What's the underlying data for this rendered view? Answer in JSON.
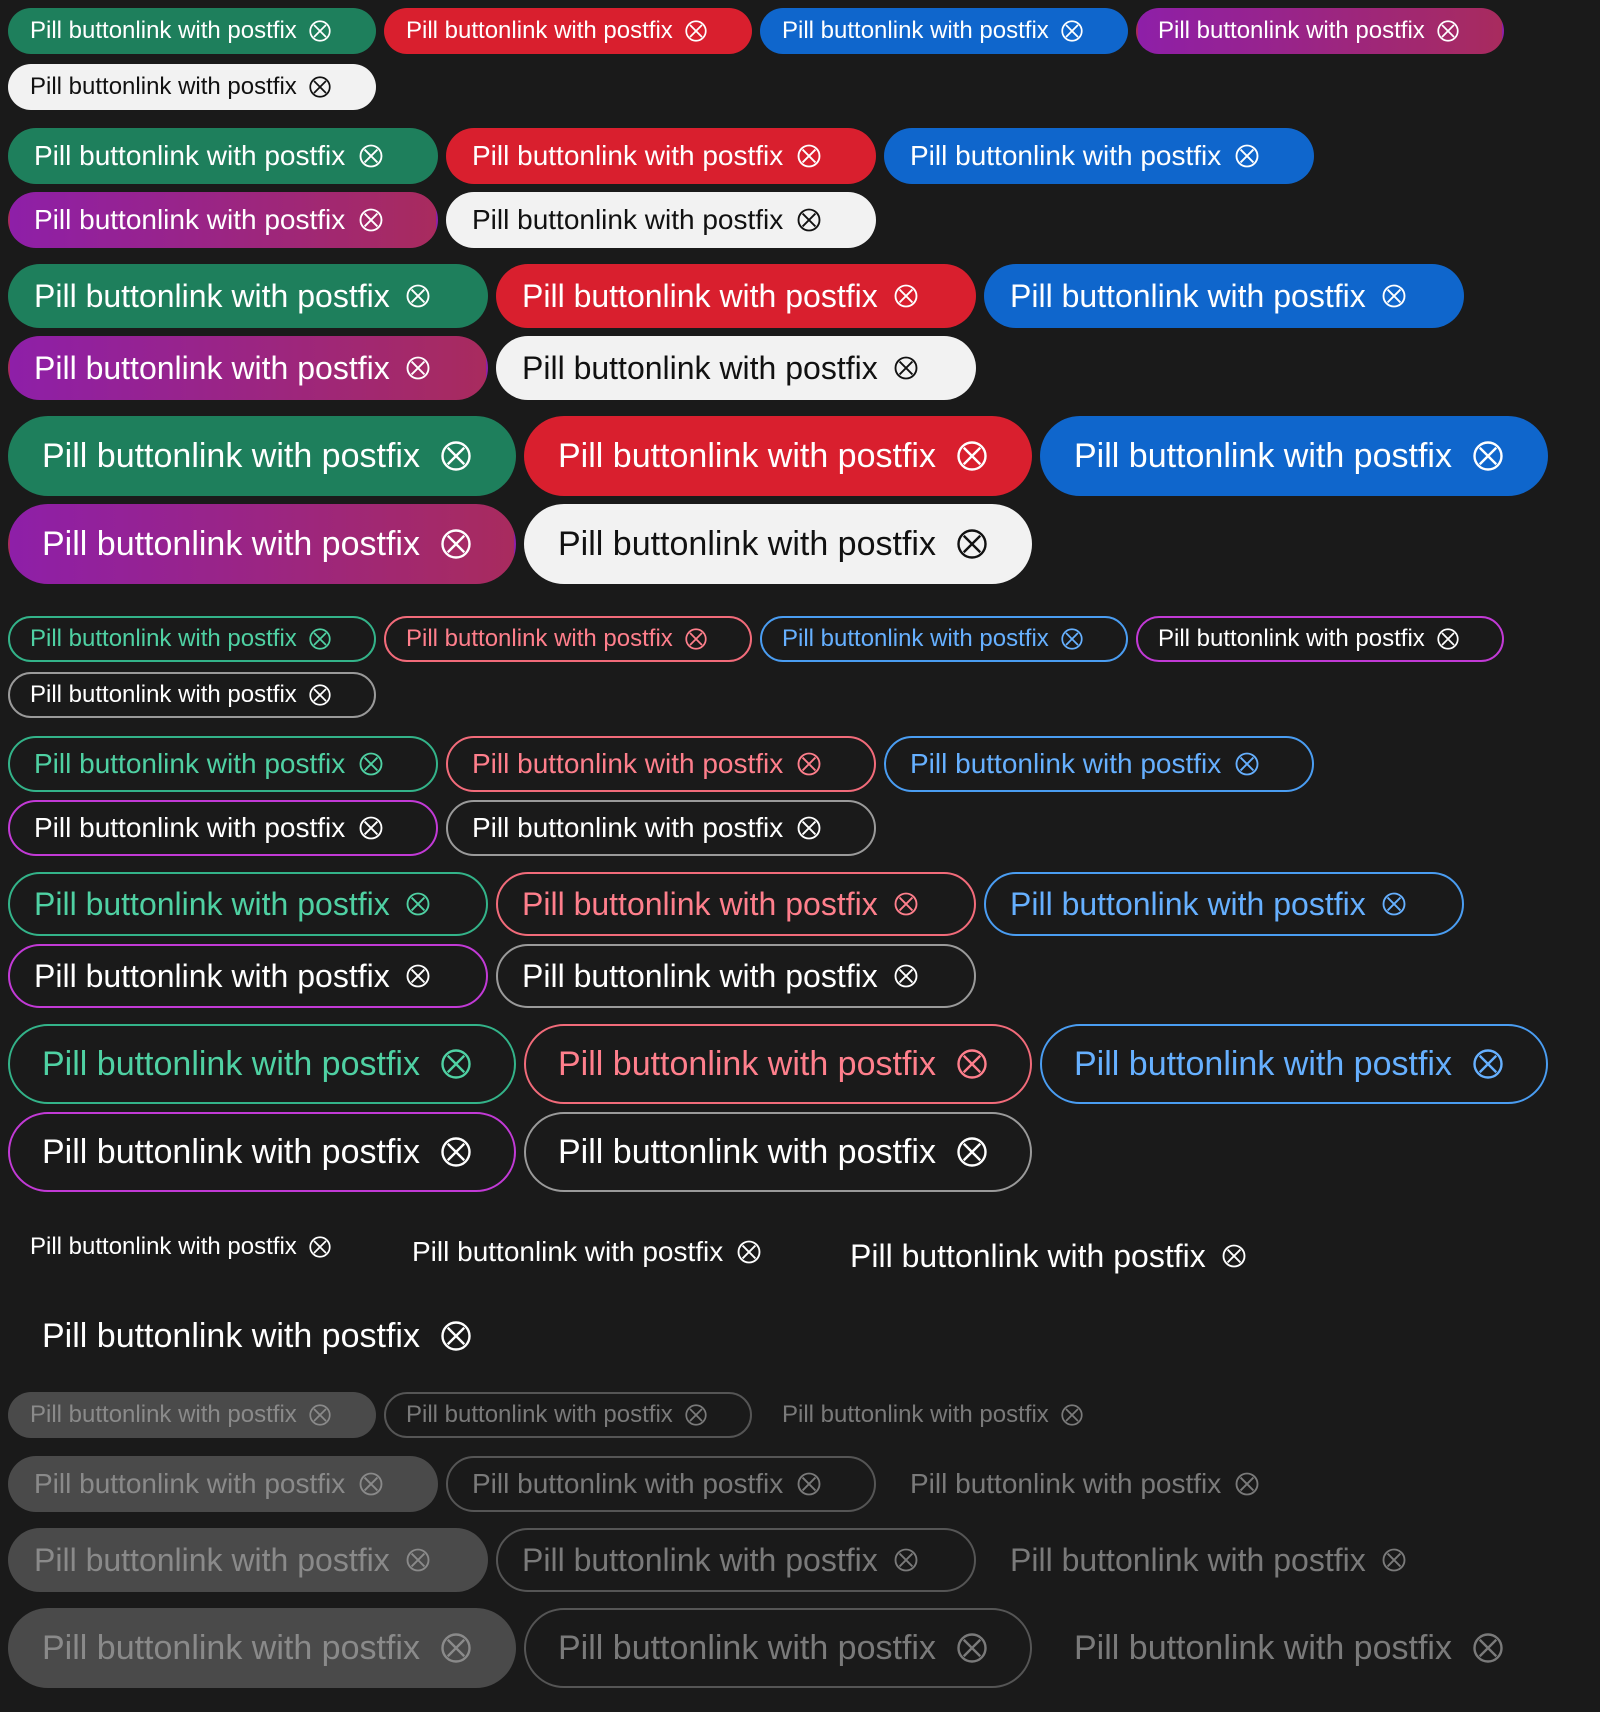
{
  "button_label": "Pill buttonlink with postfix",
  "postfix_icon": "close-circle-icon",
  "colors": {
    "background": "#1a1a1a",
    "green": "#1e7f5c",
    "red": "#d91f2e",
    "blue": "#0f66cc",
    "purple": "#8e1fa8",
    "white": "#f2f2f2",
    "disabled": "#4a4a4a"
  }
}
